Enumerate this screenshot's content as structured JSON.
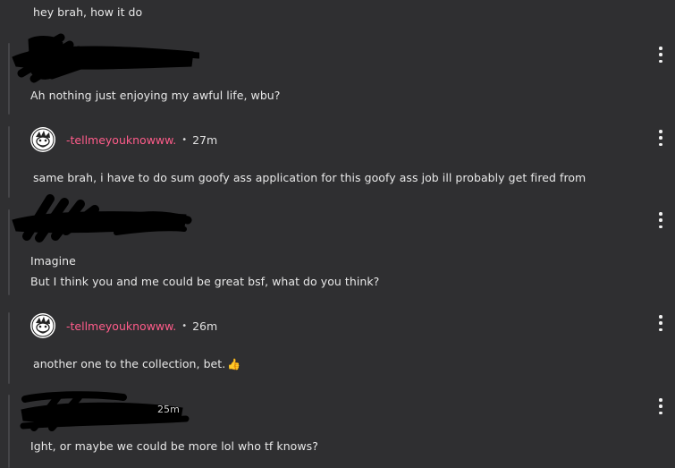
{
  "messages": [
    {
      "text": "hey brah, how it do"
    },
    {
      "text": "Ah nothing just enjoying my awful life, wbu?"
    },
    {
      "username": "-tellmeyouknowww.",
      "time": "27m",
      "text": "same brah, i have to do sum goofy ass application for this goofy ass job ill probably get fired from"
    },
    {
      "lines": [
        "Imagine",
        "But I think you and me could be great bsf, what do you think?"
      ]
    },
    {
      "username": "-tellmeyouknowww.",
      "time": "26m",
      "text": "another one to the collection, bet.",
      "emoji": "👍"
    },
    {
      "time_fragment": "25m",
      "text": "Ight, or maybe we could be more lol who tf knows?"
    }
  ],
  "separator": "•",
  "icons": {
    "more": "kebab-vertical-icon",
    "avatar": "user-avatar-icon",
    "emoji": "thumbs-up-emoji"
  },
  "colors": {
    "background": "#2f2f31",
    "username": "#ff5c8a",
    "text": "#e8e8e8",
    "thread_line": "#454548",
    "redaction": "#000000"
  }
}
